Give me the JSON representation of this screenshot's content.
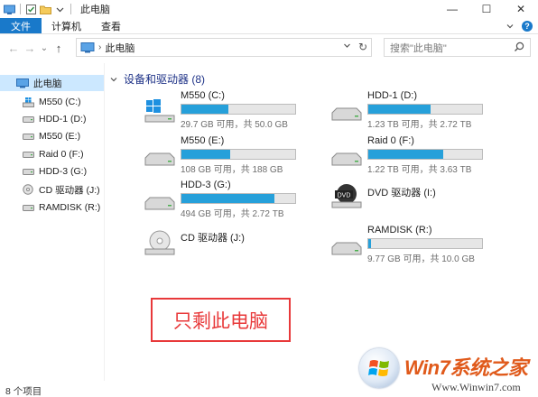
{
  "window": {
    "title": "此电脑",
    "minimize": "—",
    "maximize": "☐",
    "close": "✕"
  },
  "ribbon": {
    "tabs": [
      "文件",
      "计算机",
      "查看"
    ],
    "expand_icon": "chevron-down-icon",
    "help": "?"
  },
  "address": {
    "back": "←",
    "forward": "→",
    "recent": "⌄",
    "up": "↑",
    "path": "此电脑",
    "refresh": "↻"
  },
  "search": {
    "placeholder": "搜索\"此电脑\""
  },
  "sidebar": {
    "items": [
      {
        "label": "此电脑",
        "icon": "this-pc-icon",
        "selected": true
      },
      {
        "label": "M550 (C:)",
        "icon": "windows-drive-icon"
      },
      {
        "label": "HDD-1 (D:)",
        "icon": "drive-icon"
      },
      {
        "label": "M550 (E:)",
        "icon": "drive-icon"
      },
      {
        "label": "Raid 0 (F:)",
        "icon": "drive-icon"
      },
      {
        "label": "HDD-3 (G:)",
        "icon": "drive-icon"
      },
      {
        "label": "CD 驱动器 (J:)",
        "icon": "cd-icon"
      },
      {
        "label": "RAMDISK (R:)",
        "icon": "drive-icon"
      }
    ]
  },
  "group": {
    "title": "设备和驱动器 (8)"
  },
  "drives": [
    {
      "name": "M550 (C:)",
      "size": "29.7 GB 可用，共 50.0 GB",
      "used_fraction": 0.41,
      "type": "windows"
    },
    {
      "name": "HDD-1 (D:)",
      "size": "1.23 TB 可用，共 2.72 TB",
      "used_fraction": 0.55,
      "type": "hdd"
    },
    {
      "name": "M550 (E:)",
      "size": "108 GB 可用，共 188 GB",
      "used_fraction": 0.43,
      "type": "hdd"
    },
    {
      "name": "Raid 0 (F:)",
      "size": "1.22 TB 可用，共 3.63 TB",
      "used_fraction": 0.66,
      "type": "hdd"
    },
    {
      "name": "HDD-3 (G:)",
      "size": "494 GB 可用，共 2.72 TB",
      "used_fraction": 0.82,
      "type": "hdd"
    },
    {
      "name": "DVD 驱动器 (I:)",
      "size": "",
      "used_fraction": null,
      "type": "dvd"
    },
    {
      "name": "CD 驱动器 (J:)",
      "size": "",
      "used_fraction": null,
      "type": "cd"
    },
    {
      "name": "RAMDISK (R:)",
      "size": "9.77 GB 可用，共 10.0 GB",
      "used_fraction": 0.02,
      "type": "hdd"
    }
  ],
  "annotation": {
    "text": "只剩此电脑"
  },
  "status": {
    "item_count": "8 个项目"
  },
  "watermark": {
    "brand": "Win7系统之家",
    "url": "Www.Winwin7.com"
  },
  "colors": {
    "accent": "#1979ca",
    "bar_fill": "#26a0da",
    "group_title": "#1e3287",
    "annotation": "#e8393a",
    "selected_bg": "#cce8ff"
  }
}
